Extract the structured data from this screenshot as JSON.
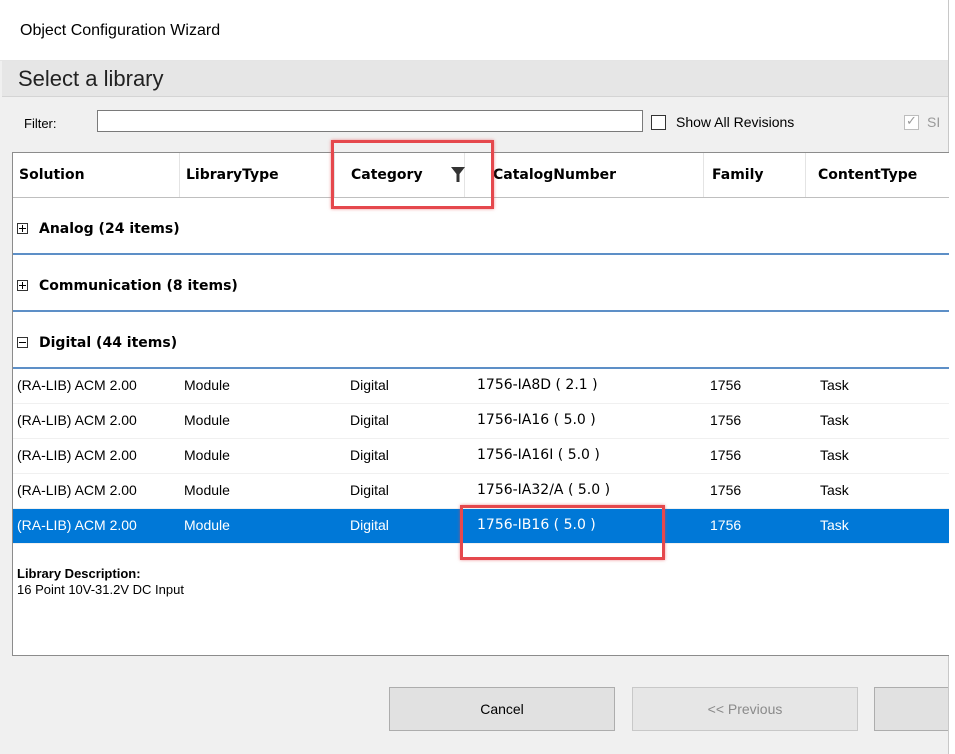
{
  "window": {
    "title": "Object Configuration Wizard"
  },
  "subheader": "Select a library",
  "filter": {
    "label": "Filter:",
    "value": "",
    "placeholder": "",
    "show_all_revisions": {
      "label": "Show All Revisions",
      "checked": false
    },
    "cut_off_checkbox": {
      "label": "SI",
      "checked": true,
      "disabled": true
    }
  },
  "grid": {
    "columns": [
      "Solution",
      "LibraryType",
      "Category",
      "CatalogNumber",
      "Family",
      "ContentType"
    ],
    "filtered_column": "Category",
    "groups": [
      {
        "label": "Analog   (24 items)",
        "expanded": false
      },
      {
        "label": "Communication   (8 items)",
        "expanded": false
      },
      {
        "label": "Digital   (44 items)",
        "expanded": true
      }
    ],
    "rows": [
      {
        "solution": "(RA-LIB) ACM 2.00",
        "library_type": "Module",
        "category": "Digital",
        "catalog": "1756-IA8D  ( 2.1 )",
        "family": "1756",
        "content_type": "Task",
        "selected": false
      },
      {
        "solution": "(RA-LIB) ACM 2.00",
        "library_type": "Module",
        "category": "Digital",
        "catalog": "1756-IA16  ( 5.0 )",
        "family": "1756",
        "content_type": "Task",
        "selected": false
      },
      {
        "solution": "(RA-LIB) ACM 2.00",
        "library_type": "Module",
        "category": "Digital",
        "catalog": "1756-IA16I  ( 5.0 )",
        "family": "1756",
        "content_type": "Task",
        "selected": false
      },
      {
        "solution": "(RA-LIB) ACM 2.00",
        "library_type": "Module",
        "category": "Digital",
        "catalog": "1756-IA32/A  ( 5.0 )",
        "family": "1756",
        "content_type": "Task",
        "selected": false
      },
      {
        "solution": "(RA-LIB) ACM 2.00",
        "library_type": "Module",
        "category": "Digital",
        "catalog": "1756-IB16  ( 5.0 )",
        "family": "1756",
        "content_type": "Task",
        "selected": true
      }
    ]
  },
  "description": {
    "label": "Library Description:",
    "value": "16 Point 10V-31.2V DC Input"
  },
  "buttons": {
    "cancel": "Cancel",
    "previous": "<< Previous",
    "next": ""
  },
  "colors": {
    "selection": "#0078d7",
    "group_underline": "#5d8fc7",
    "highlight": "#e5484d"
  }
}
